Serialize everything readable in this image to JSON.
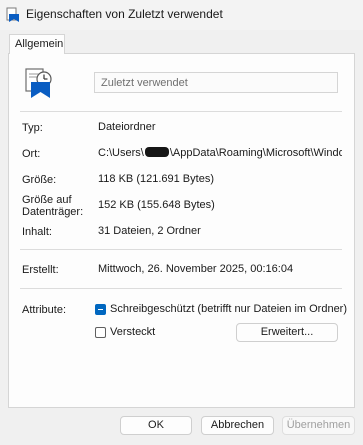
{
  "window": {
    "title": "Eigenschaften von Zuletzt verwendet"
  },
  "tabs": [
    {
      "label": "Allgemein",
      "active": true
    }
  ],
  "header": {
    "name_value": "Zuletzt verwendet",
    "icon": "folder-recent-icon"
  },
  "properties": {
    "type": {
      "label": "Typ:",
      "value": "Dateiordner"
    },
    "location": {
      "label": "Ort:",
      "path_prefix": "C:\\Users\\",
      "path_suffix": "\\AppData\\Roaming\\Microsoft\\Windows\\Recent"
    },
    "size": {
      "label": "Größe:",
      "value": "118 KB (121.691 Bytes)"
    },
    "size_on_disk": {
      "label_line1": "Größe auf",
      "label_line2": "Datenträger:",
      "value": "152 KB (155.648 Bytes)"
    },
    "contents": {
      "label": "Inhalt:",
      "value": "31 Dateien, 2 Ordner"
    },
    "created": {
      "label": "Erstellt:",
      "value": "Mittwoch, 26. November 2025, 00:16:04"
    }
  },
  "attributes": {
    "label": "Attribute:",
    "readonly": {
      "label": "Schreibgeschützt (betrifft nur Dateien im Ordner)",
      "state": "indeterminate"
    },
    "hidden": {
      "label": "Versteckt",
      "checked": false
    },
    "advanced_button": "Erweitert..."
  },
  "footer": {
    "ok": "OK",
    "cancel": "Abbrechen",
    "apply": "Übernehmen"
  },
  "colors": {
    "accent": "#0067c0",
    "icon_blue": "#0a5dc2"
  }
}
